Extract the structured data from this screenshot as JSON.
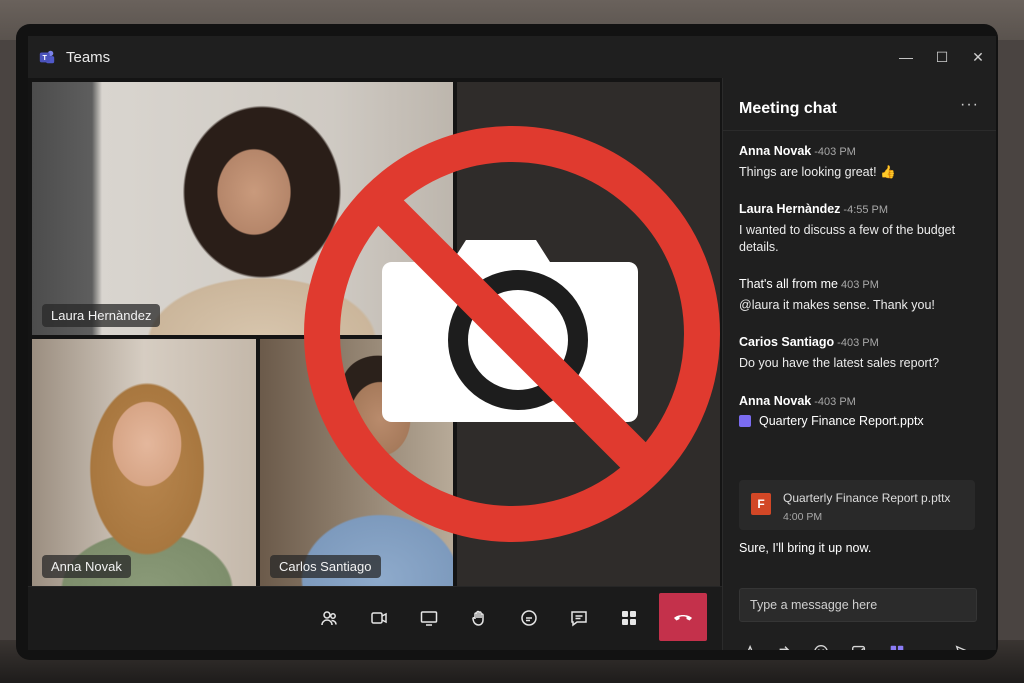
{
  "app": {
    "title": "Teams"
  },
  "window_controls": {
    "minimize": "—",
    "maximize": "☐",
    "close": "✕"
  },
  "participants": [
    {
      "name": "Laura Hernàndez"
    },
    {
      "name": "Anna Novak"
    },
    {
      "name": "Carlos Santiago"
    }
  ],
  "toolbar": {
    "items": [
      "people-icon",
      "camera-icon",
      "share-screen-icon",
      "raise-hand-icon",
      "reactions-icon",
      "chat-icon",
      "apps-icon",
      "leave-icon"
    ]
  },
  "chat": {
    "title": "Meeting chat",
    "more": "···",
    "messages": [
      {
        "author": "Anna Novak",
        "time": "-403 PM",
        "text": "Things are looking great! 👍"
      },
      {
        "author": "Laura Hernàndez",
        "time": "-4:55 PM",
        "text": "I wanted to discuss a few of the budget details."
      },
      {
        "author": "That's all from me",
        "time": "403 PM",
        "text": "@laura it makes sense. Thank you!"
      },
      {
        "author": "Carios Santiago",
        "time": "-403 PM",
        "text": "Do you have the latest sales report?"
      },
      {
        "author": "Anna Novak",
        "time": "-403 PM",
        "file": "Quartery Finance Report.pptx"
      }
    ],
    "file_card": {
      "icon": "F",
      "name": "Quarterly Finance Report p.pttx",
      "time": "4:00 PM"
    },
    "reply": "Sure, I'll bring it up now.",
    "compose_placeholder": "Type a messagge here"
  },
  "colors": {
    "leave": "#c4314b",
    "no_camera": "#e03a2f",
    "accent": "#7b6cf0"
  }
}
